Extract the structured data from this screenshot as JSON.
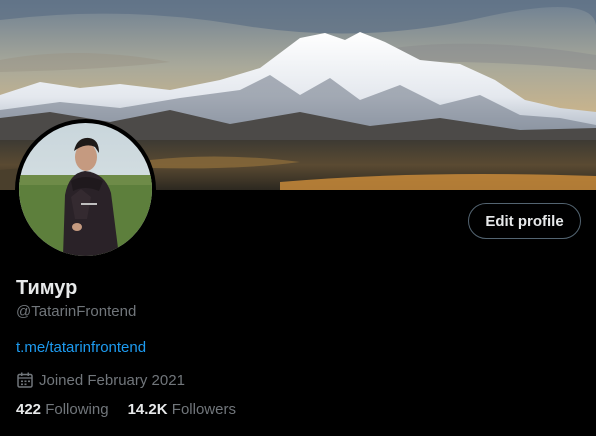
{
  "banner": {
    "icon": "mountain-landscape-image"
  },
  "avatar": {
    "icon": "user-photo"
  },
  "buttons": {
    "edit_profile": "Edit profile"
  },
  "profile": {
    "display_name": "Тимур",
    "handle": "@TatarinFrontend",
    "bio_link": "t.me/tatarinfrontend",
    "joined": "Joined February 2021"
  },
  "stats": {
    "following_count": "422",
    "following_label": "Following",
    "followers_count": "14.2K",
    "followers_label": "Followers"
  },
  "colors": {
    "background": "#000000",
    "text_primary": "#e7e9ea",
    "text_secondary": "#71767b",
    "link": "#1d9bf0",
    "button_border": "#536471"
  }
}
